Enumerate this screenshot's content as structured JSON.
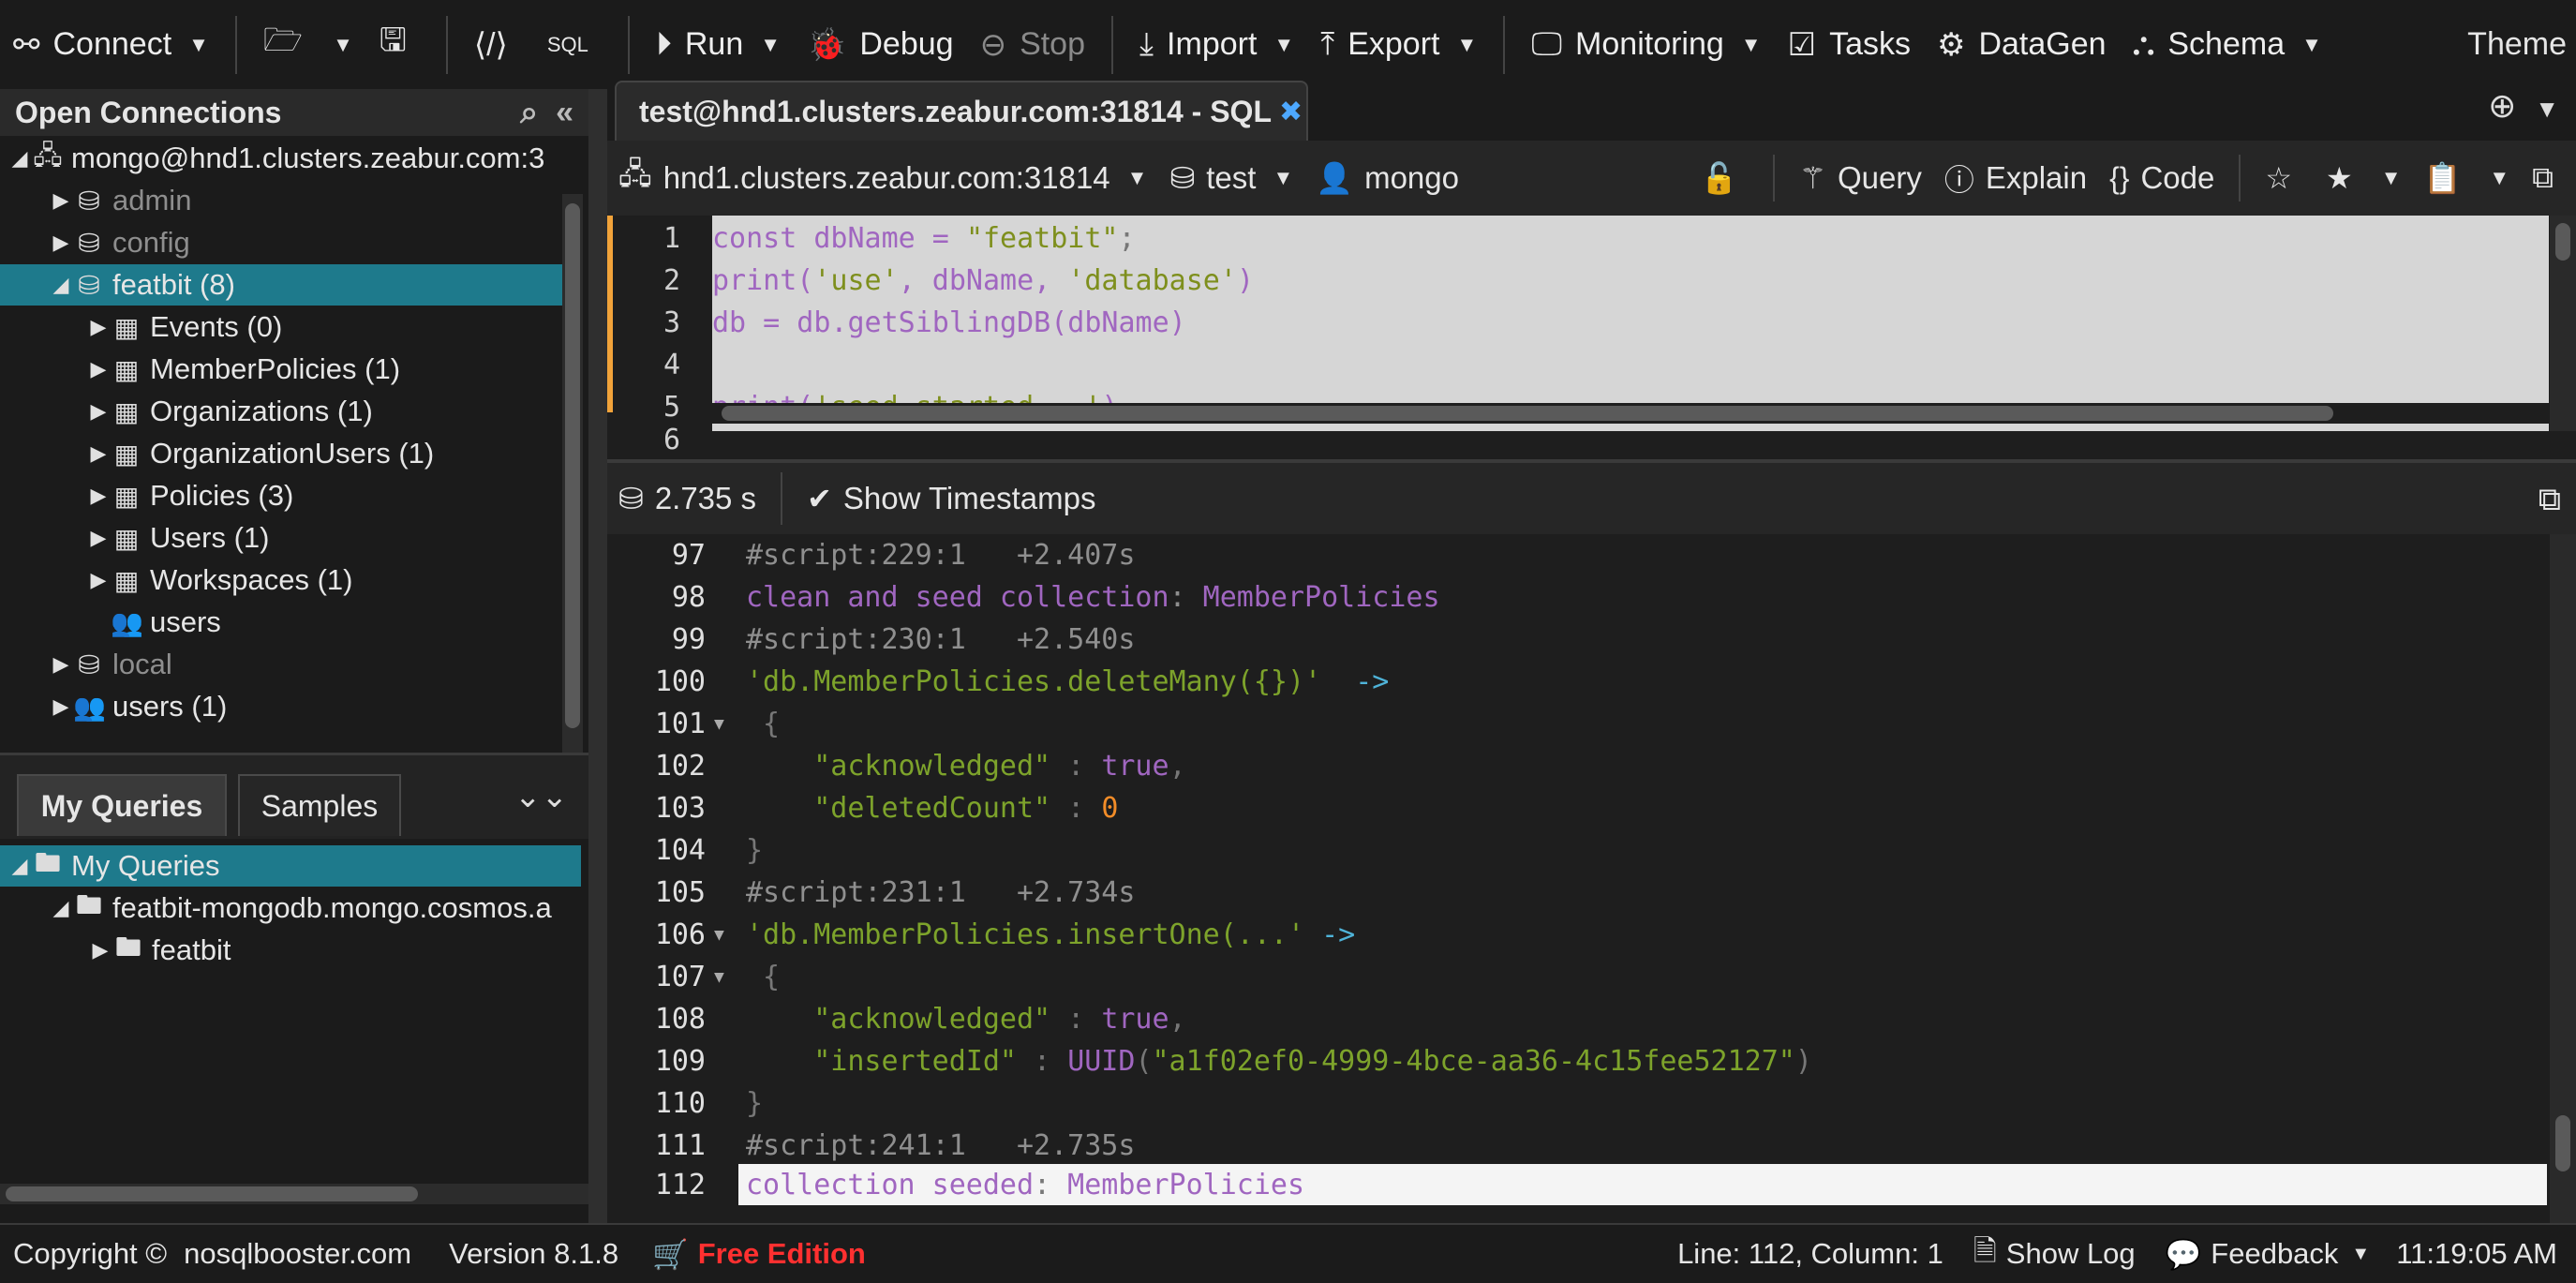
{
  "toolbar": {
    "connect": "Connect",
    "run": "Run",
    "debug": "Debug",
    "stop": "Stop",
    "import": "Import",
    "export": "Export",
    "monitoring": "Monitoring",
    "tasks": "Tasks",
    "datagen": "DataGen",
    "schema": "Schema",
    "theme": "Theme"
  },
  "left_panel": {
    "title": "Open Connections",
    "tree": [
      {
        "label": "mongo@hnd1.clusters.zeabur.com:3"
      },
      {
        "label": "admin"
      },
      {
        "label": "config"
      },
      {
        "label": "featbit (8)"
      },
      {
        "label": "Events (0)"
      },
      {
        "label": "MemberPolicies (1)"
      },
      {
        "label": "Organizations (1)"
      },
      {
        "label": "OrganizationUsers (1)"
      },
      {
        "label": "Policies (3)"
      },
      {
        "label": "Users (1)"
      },
      {
        "label": "Workspaces (1)"
      },
      {
        "label": "users"
      },
      {
        "label": "local"
      },
      {
        "label": "users (1)"
      }
    ],
    "query_tabs": [
      "My Queries",
      "Samples"
    ],
    "query_tree": [
      {
        "label": "My Queries"
      },
      {
        "label": "featbit-mongodb.mongo.cosmos.a"
      },
      {
        "label": "featbit"
      }
    ]
  },
  "editor": {
    "tab_title": "test@hnd1.clusters.zeabur.com:31814 - SQL",
    "host": "hnd1.clusters.zeabur.com:31814",
    "database": "test",
    "user": "mongo",
    "query": "Query",
    "explain": "Explain",
    "code": "Code",
    "line_numbers": [
      "1",
      "2",
      "3",
      "4",
      "5",
      "6"
    ]
  },
  "results": {
    "elapsed": "2.735 s",
    "show_timestamps": "Show Timestamps",
    "line_numbers": [
      "97",
      "98",
      "99",
      "100",
      "101",
      "102",
      "103",
      "104",
      "105",
      "106",
      "107",
      "108",
      "109",
      "110",
      "111",
      "112"
    ]
  },
  "statusbar": {
    "copyright": "Copyright ©",
    "site": "nosqlbooster.com",
    "version": "Version 8.1.8",
    "edition": "Free Edition",
    "position": "Line: 112, Column: 1",
    "show_log": "Show Log",
    "feedback": "Feedback",
    "time": "11:19:05 AM"
  },
  "colors": {
    "selection": "#1e7a8c",
    "edition": "#ff3030",
    "modified_marker": "#f2a33a"
  }
}
